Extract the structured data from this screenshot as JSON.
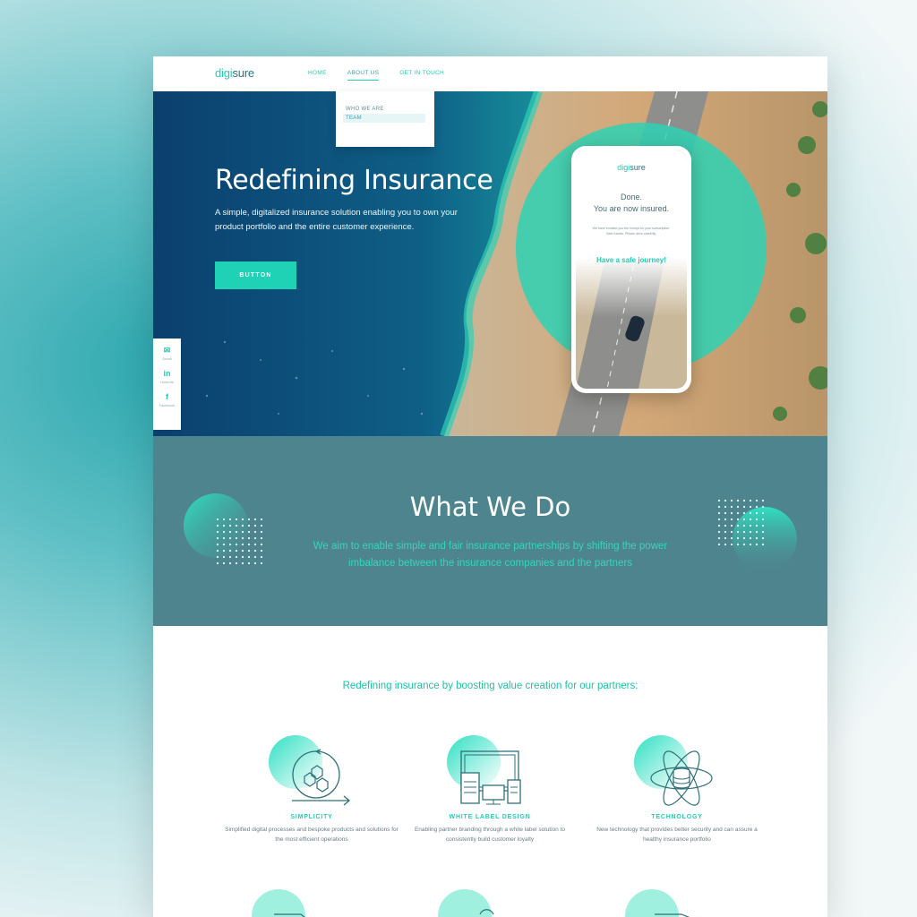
{
  "brand": {
    "logo_a": "digi",
    "logo_b": "sure"
  },
  "nav": {
    "links": [
      "HOME",
      "ABOUT US",
      "GET IN TOUCH"
    ],
    "dropdown": [
      "WHO WE ARE",
      "TEAM"
    ]
  },
  "hero": {
    "title": "Redefining Insurance",
    "subtitle": "A simple, digitalized insurance solution enabling you to own your product portfolio and the entire customer experience.",
    "button": "BUTTON"
  },
  "social": {
    "items": [
      "Email",
      "LinkedIn",
      "Facebook"
    ]
  },
  "phone": {
    "done": "Done.",
    "insured": "You are now insured.",
    "small": "We have emailed you the receipt for your subscription. Safe travels. Please drive carefully.",
    "safe": "Have a safe journey!"
  },
  "wwd": {
    "title": "What We Do",
    "text": "We aim to enable simple and fair insurance partnerships by shifting the power imbalance between the insurance companies and the partners"
  },
  "value": {
    "heading": "Redefining insurance by boosting value creation for our partners:",
    "features": [
      {
        "title": "SIMPLICITY",
        "desc": "Simplified digital processes and bespoke products and solutions for the most efficient operations"
      },
      {
        "title": "WHITE LABEL DESIGN",
        "desc": "Enabling partner branding through a white label solution to consistently build customer loyalty"
      },
      {
        "title": "TECHNOLOGY",
        "desc": "New technology that provides better security and can assure a healthy insurance portfolio"
      }
    ]
  },
  "colors": {
    "accent": "#1fcfb2",
    "teal_dark": "#4e848d",
    "text_dark": "#2f6f78"
  }
}
